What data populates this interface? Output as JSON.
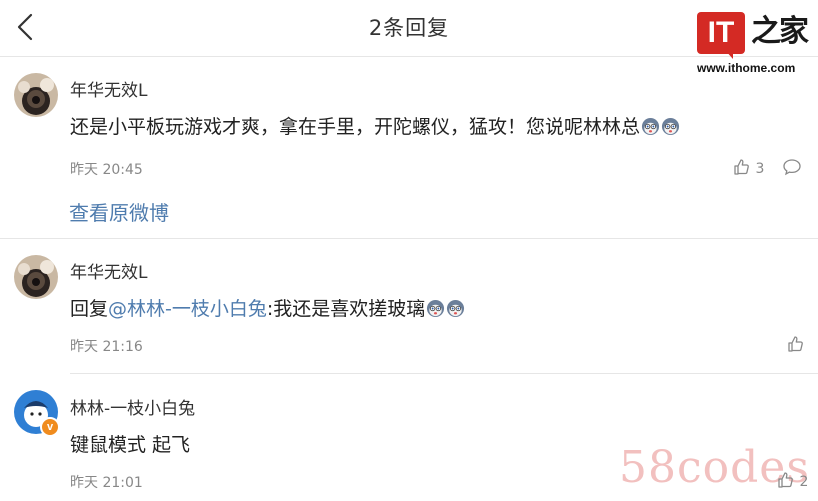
{
  "header": {
    "title": "2条回复",
    "back_icon": "chevron-left-icon"
  },
  "logo": {
    "it_text": "IT",
    "home_text": "之家",
    "url": "www.ithome.com"
  },
  "comments": [
    {
      "username": "年华无效L",
      "text": "还是小平板玩游戏才爽，拿在手里，开陀螺仪，猛攻！您说呢林林总",
      "emojis": [
        "husky-emoji",
        "husky-emoji"
      ],
      "time": "昨天 20:45",
      "like_count": "3",
      "link": "查看原微博"
    },
    {
      "username": "年华无效L",
      "reply_prefix": "回复",
      "mention": "@林林-一枝小白兔",
      "text": ":我还是喜欢搓玻璃",
      "emojis": [
        "husky-emoji",
        "husky-emoji"
      ],
      "time": "昨天 21:16",
      "like_count": ""
    },
    {
      "username": "林林-一枝小白兔",
      "text": "键鼠模式 起飞",
      "time": "昨天 21:01",
      "like_count": "2",
      "verified_badge": "v"
    }
  ],
  "watermark": "58codes",
  "colors": {
    "link": "#4f7cae",
    "brand_red": "#d42a24",
    "meta_gray": "#888888",
    "divider": "#e6e6e6"
  }
}
